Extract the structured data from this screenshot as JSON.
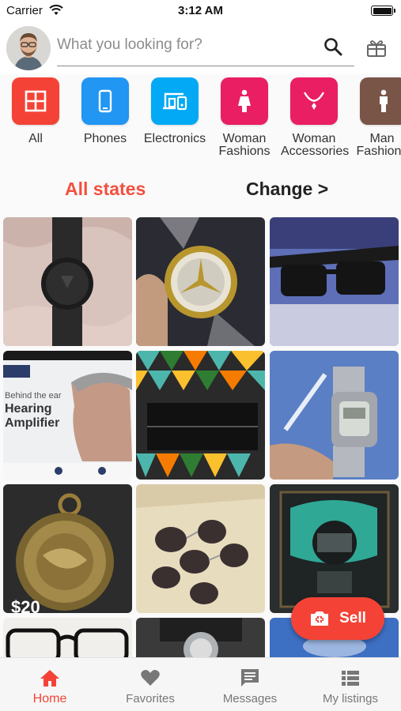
{
  "status_bar": {
    "carrier": "Carrier",
    "time": "3:12 AM"
  },
  "search": {
    "placeholder": "What you looking for?"
  },
  "categories": [
    {
      "label": "All",
      "color": "#f44336",
      "icon": "grid-icon"
    },
    {
      "label": "Phones",
      "color": "#2196f3",
      "icon": "phone-icon"
    },
    {
      "label": "Electronics",
      "color": "#03a9f4",
      "icon": "devices-icon"
    },
    {
      "label": "Woman Fashions",
      "color": "#e91e63",
      "icon": "woman-icon"
    },
    {
      "label": "Woman Accessories",
      "color": "#e91e63",
      "icon": "necklace-icon"
    },
    {
      "label": "Man Fashions",
      "color": "#795548",
      "icon": "man-icon"
    }
  ],
  "filter": {
    "states": "All states",
    "change": "Change >"
  },
  "listings": [
    {
      "subject": "black wristwatch"
    },
    {
      "subject": "mercedes diamond watch"
    },
    {
      "subject": "black sunglasses"
    },
    {
      "subject": "hearing amplifier box"
    },
    {
      "subject": "geometric pattern wallet"
    },
    {
      "subject": "digital sports watch"
    },
    {
      "subject": "bronze pocket watch",
      "price": "$20"
    },
    {
      "subject": "aviator sunglasses set"
    },
    {
      "subject": "framed poster"
    },
    {
      "subject": "eyeglasses"
    },
    {
      "subject": "watch on display"
    },
    {
      "subject": "blue item"
    }
  ],
  "fab": {
    "label": "Sell"
  },
  "nav": [
    {
      "label": "Home",
      "active": true
    },
    {
      "label": "Favorites",
      "active": false
    },
    {
      "label": "Messages",
      "active": false
    },
    {
      "label": "My listings",
      "active": false
    }
  ],
  "colors": {
    "accent": "#f44336",
    "active_text": "#f44336"
  }
}
